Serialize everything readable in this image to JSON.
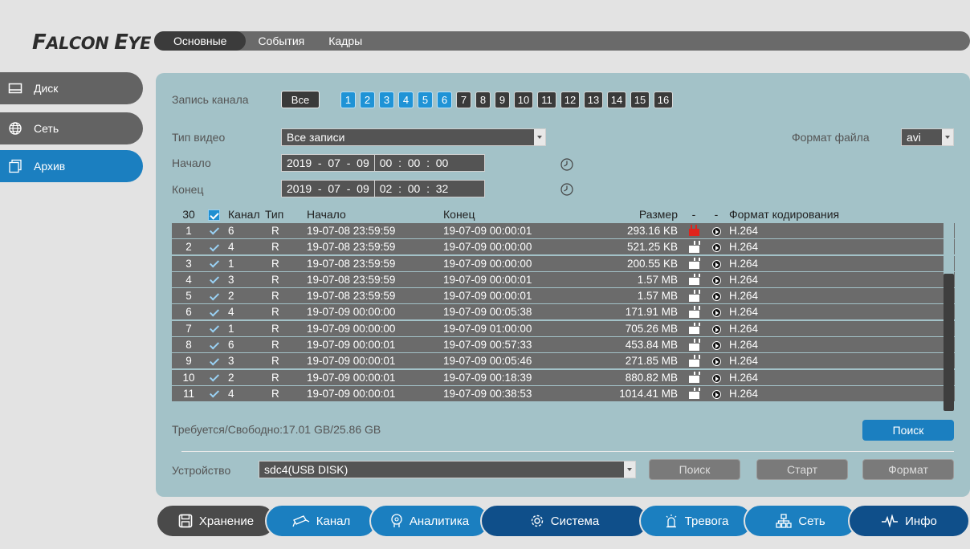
{
  "logo": {
    "f": "F",
    "alcon": "ALCON",
    "e": "E",
    "ye": "YE"
  },
  "top_tabs": [
    "Основные",
    "События",
    "Кадры"
  ],
  "sidebar": [
    {
      "label": "Диск",
      "icon": "disk-icon"
    },
    {
      "label": "Сеть",
      "icon": "network-globe-icon"
    },
    {
      "label": "Архив",
      "icon": "archive-icon"
    }
  ],
  "filters": {
    "channel_label": "Запись канала",
    "all_label": "Все",
    "channels": [
      "1",
      "2",
      "3",
      "4",
      "5",
      "6",
      "7",
      "8",
      "9",
      "10",
      "11",
      "12",
      "13",
      "14",
      "15",
      "16"
    ],
    "channels_selected": [
      "1",
      "2",
      "3",
      "4",
      "5",
      "6"
    ],
    "video_type_label": "Тип видео",
    "video_type_value": "Все записи",
    "file_format_label": "Формат файла",
    "file_format_value": "avi",
    "start_label": "Начало",
    "start_date": "2019  -  07  -  09",
    "start_time": "00  :  00  :  00",
    "end_label": "Конец",
    "end_date": "2019  -  07  -  09",
    "end_time": "02  :  00  :  32"
  },
  "table": {
    "count": "30",
    "headers": {
      "channel": "Канал",
      "type": "Тип",
      "start": "Начало",
      "end": "Конец",
      "size": "Размер",
      "dash1": "-",
      "dash2": "-",
      "codec": "Формат кодирования"
    },
    "rows": [
      {
        "n": "1",
        "ch": "6",
        "type": "R",
        "start": "19-07-08 23:59:59",
        "end": "19-07-09 00:00:01",
        "size": "293.16 KB",
        "locked": true,
        "codec": "H.264"
      },
      {
        "n": "2",
        "ch": "4",
        "type": "R",
        "start": "19-07-08 23:59:59",
        "end": "19-07-09 00:00:00",
        "size": "521.25 KB",
        "locked": false,
        "codec": "H.264"
      },
      {
        "n": "3",
        "ch": "1",
        "type": "R",
        "start": "19-07-08 23:59:59",
        "end": "19-07-09 00:00:00",
        "size": "200.55 KB",
        "locked": false,
        "codec": "H.264"
      },
      {
        "n": "4",
        "ch": "3",
        "type": "R",
        "start": "19-07-08 23:59:59",
        "end": "19-07-09 00:00:01",
        "size": "1.57 MB",
        "locked": false,
        "codec": "H.264"
      },
      {
        "n": "5",
        "ch": "2",
        "type": "R",
        "start": "19-07-08 23:59:59",
        "end": "19-07-09 00:00:01",
        "size": "1.57 MB",
        "locked": false,
        "codec": "H.264"
      },
      {
        "n": "6",
        "ch": "4",
        "type": "R",
        "start": "19-07-09 00:00:00",
        "end": "19-07-09 00:05:38",
        "size": "171.91 MB",
        "locked": false,
        "codec": "H.264"
      },
      {
        "n": "7",
        "ch": "1",
        "type": "R",
        "start": "19-07-09 00:00:00",
        "end": "19-07-09 01:00:00",
        "size": "705.26 MB",
        "locked": false,
        "codec": "H.264"
      },
      {
        "n": "8",
        "ch": "6",
        "type": "R",
        "start": "19-07-09 00:00:01",
        "end": "19-07-09 00:57:33",
        "size": "453.84 MB",
        "locked": false,
        "codec": "H.264"
      },
      {
        "n": "9",
        "ch": "3",
        "type": "R",
        "start": "19-07-09 00:00:01",
        "end": "19-07-09 00:05:46",
        "size": "271.85 MB",
        "locked": false,
        "codec": "H.264"
      },
      {
        "n": "10",
        "ch": "2",
        "type": "R",
        "start": "19-07-09 00:00:01",
        "end": "19-07-09 00:18:39",
        "size": "880.82 MB",
        "locked": false,
        "codec": "H.264"
      },
      {
        "n": "11",
        "ch": "4",
        "type": "R",
        "start": "19-07-09 00:00:01",
        "end": "19-07-09 00:38:53",
        "size": "1014.41 MB",
        "locked": false,
        "codec": "H.264"
      }
    ]
  },
  "storage_text": "Требуется/Свободно:17.01 GB/25.86 GB",
  "search_button": "Поиск",
  "device": {
    "label": "Устройство",
    "value": "sdc4(USB DISK)",
    "search_button": "Поиск",
    "start_button": "Старт",
    "format_button": "Формат"
  },
  "bottom_nav": [
    {
      "label": "Хранение",
      "icon": "storage-icon",
      "color": "#4a4a4a"
    },
    {
      "label": "Канал",
      "icon": "camera-icon",
      "color": "#1b7fc0"
    },
    {
      "label": "Аналитика",
      "icon": "analytics-icon",
      "color": "#1b7fc0"
    },
    {
      "label": "Система",
      "icon": "gear-icon",
      "color": "#0f4f8a"
    },
    {
      "label": "Тревога",
      "icon": "alarm-icon",
      "color": "#1b7fc0"
    },
    {
      "label": "Сеть",
      "icon": "network-icon",
      "color": "#1b7fc0"
    },
    {
      "label": "Инфо",
      "icon": "pulse-icon",
      "color": "#0f4f8a"
    }
  ],
  "colors": {
    "accent": "#1b7fc0",
    "panel": "#a3c2c8",
    "row": "#6b6b6b",
    "lock_red": "#e0231c"
  }
}
